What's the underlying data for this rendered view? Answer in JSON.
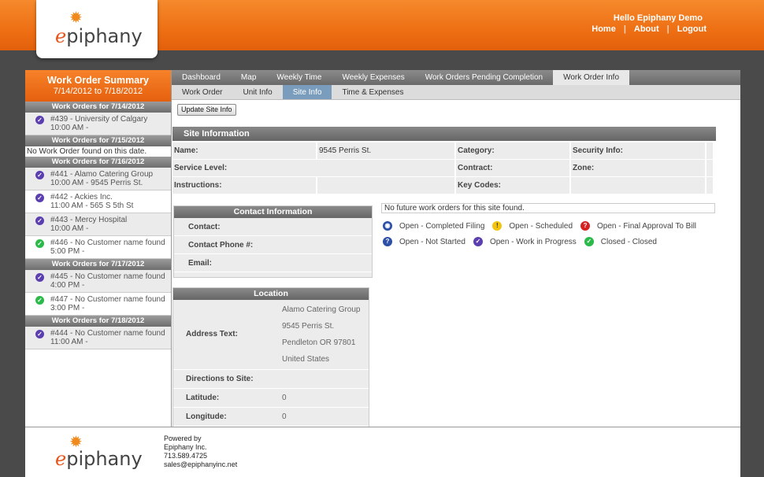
{
  "header": {
    "logo_text": "piphany",
    "logo_letter": "e",
    "greeting": "Hello Epiphany Demo",
    "nav": [
      "Home",
      "About",
      "Logout"
    ]
  },
  "sidebar": {
    "title": "Work Order Summary",
    "date_range": "7/14/2012 to 7/18/2012",
    "groups": [
      {
        "header": "Work Orders for 7/14/2012",
        "items": [
          {
            "line1": "#439 - University of Calgary",
            "line2": "10:00 AM -",
            "status": "purple"
          }
        ]
      },
      {
        "header": "Work Orders for 7/15/2012",
        "empty": "No Work Order found on this date.",
        "items": []
      },
      {
        "header": "Work Orders for 7/16/2012",
        "items": [
          {
            "line1": "#441 - Alamo Catering Group",
            "line2": "10:00 AM - 9545 Perris St.",
            "status": "purple"
          },
          {
            "line1": "#442 - Ackies Inc.",
            "line2": "11:00 AM - 565 S 5th St",
            "status": "purple"
          },
          {
            "line1": "#443 - Mercy Hospital",
            "line2": "10:00 AM -",
            "status": "purple"
          },
          {
            "line1": "#446 - No Customer name found",
            "line2": "5:00 PM -",
            "status": "green"
          }
        ]
      },
      {
        "header": "Work Orders for 7/17/2012",
        "items": [
          {
            "line1": "#445 - No Customer name found",
            "line2": "4:00 PM -",
            "status": "purple"
          },
          {
            "line1": "#447 - No Customer name found",
            "line2": "3:00 PM -",
            "status": "green"
          }
        ]
      },
      {
        "header": "Work Orders for 7/18/2012",
        "items": [
          {
            "line1": "#444 - No Customer name found",
            "line2": "11:00 AM -",
            "status": "purple"
          }
        ]
      }
    ]
  },
  "tabs": [
    "Dashboard",
    "Map",
    "Weekly Time",
    "Weekly Expenses",
    "Work Orders Pending Completion",
    "Work Order Info"
  ],
  "active_tab": "Work Order Info",
  "subtabs": [
    "Work Order",
    "Unit Info",
    "Site Info",
    "Time & Expenses"
  ],
  "active_subtab": "Site Info",
  "update_button": "Update Site Info",
  "site_info": {
    "header": "Site Information",
    "name_label": "Name:",
    "name_value": "9545 Perris St.",
    "category_label": "Category:",
    "security_label": "Security Info:",
    "service_label": "Service Level:",
    "contract_label": "Contract:",
    "zone_label": "Zone:",
    "instructions_label": "Instructions:",
    "keycodes_label": "Key Codes:"
  },
  "contact": {
    "header": "Contact Information",
    "contact_label": "Contact:",
    "phone_label": "Contact Phone #:",
    "email_label": "Email:"
  },
  "location": {
    "header": "Location",
    "address_label": "Address Text:",
    "address_lines": [
      "Alamo Catering Group",
      "9545 Perris St.",
      "Pendleton OR 97801",
      "United States"
    ],
    "directions_label": "Directions to Site:",
    "latitude_label": "Latitude:",
    "latitude_value": "0",
    "longitude_label": "Longitude:",
    "longitude_value": "0"
  },
  "future_msg": "No future work orders for this site found.",
  "legend": [
    {
      "label": "Open - Completed Filing",
      "icon": "blue-circle-icon",
      "color": "#2d4fa8"
    },
    {
      "label": "Open - Scheduled",
      "icon": "yellow-exclamation-icon",
      "color": "#f2c40f"
    },
    {
      "label": "Open - Final Approval To Bill",
      "icon": "red-question-icon",
      "color": "#d42222"
    },
    {
      "label": "Open - Not Started",
      "icon": "blue-question-icon",
      "color": "#2d4fa8"
    },
    {
      "label": "Open - Work in Progress",
      "icon": "purple-check-icon",
      "color": "#5b3fb0"
    },
    {
      "label": "Closed - Closed",
      "icon": "green-check-icon",
      "color": "#2bb94a"
    }
  ],
  "footer": {
    "powered_by": "Powered by",
    "company": "Epiphany Inc.",
    "phone": "713.589.4725",
    "email": "sales@epiphanyinc.net"
  }
}
